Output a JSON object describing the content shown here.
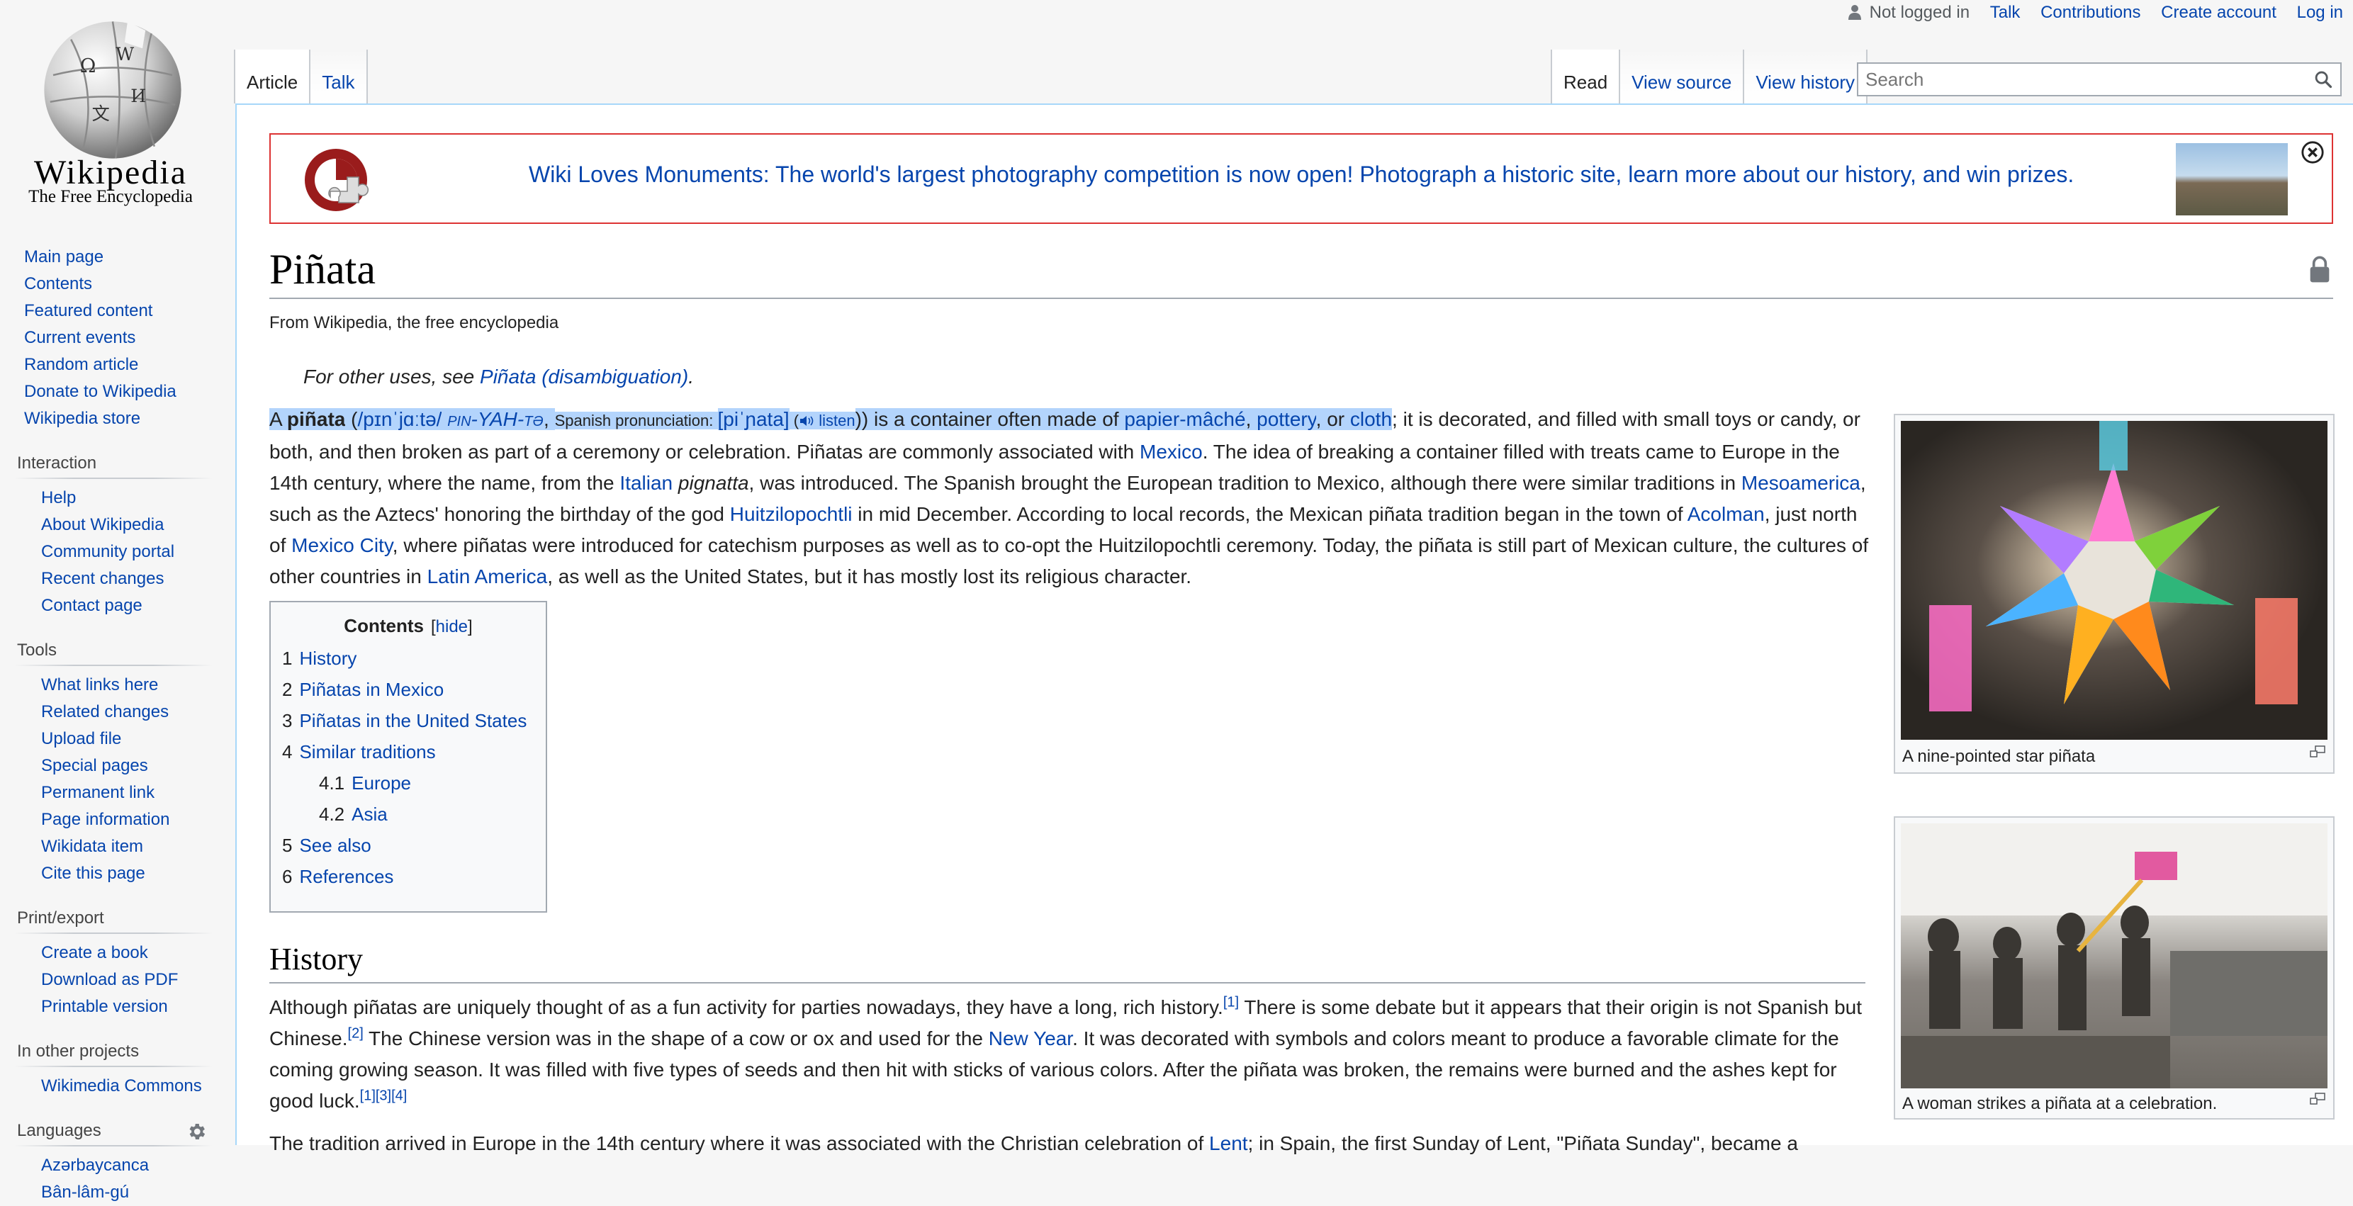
{
  "logo": {
    "wordmark": "Wikipedia",
    "tagline": "The Free Encyclopedia"
  },
  "personal": {
    "not_logged_in": "Not logged in",
    "talk": "Talk",
    "contributions": "Contributions",
    "create_account": "Create account",
    "log_in": "Log in"
  },
  "tabs": {
    "article": "Article",
    "talk": "Talk",
    "read": "Read",
    "view_source": "View source",
    "view_history": "View history"
  },
  "search": {
    "placeholder": "Search"
  },
  "sidebar": {
    "navigation": [
      "Main page",
      "Contents",
      "Featured content",
      "Current events",
      "Random article",
      "Donate to Wikipedia",
      "Wikipedia store"
    ],
    "interaction_heading": "Interaction",
    "interaction": [
      "Help",
      "About Wikipedia",
      "Community portal",
      "Recent changes",
      "Contact page"
    ],
    "tools_heading": "Tools",
    "tools": [
      "What links here",
      "Related changes",
      "Upload file",
      "Special pages",
      "Permanent link",
      "Page information",
      "Wikidata item",
      "Cite this page"
    ],
    "print_heading": "Print/export",
    "print": [
      "Create a book",
      "Download as PDF",
      "Printable version"
    ],
    "projects_heading": "In other projects",
    "projects": [
      "Wikimedia Commons"
    ],
    "languages_heading": "Languages",
    "languages": [
      "Azərbaycanca",
      "Bân-lâm-gú"
    ]
  },
  "banner": {
    "text": "Wiki Loves Monuments: The world's largest photography competition is now open! Photograph a historic site, learn more about our history, and win prizes."
  },
  "article": {
    "title": "Piñata",
    "tagline": "From Wikipedia, the free encyclopedia",
    "hatnote_prefix": "For other uses, see ",
    "hatnote_link": "Piñata (disambiguation)",
    "hatnote_suffix": ".",
    "p1": {
      "a": "A ",
      "piñata": "piñata",
      "b": " (",
      "ipa": "/pɪnˈjɑːtə/",
      "respell": "pin-YAH-tə",
      "c": ", ",
      "spanish_pron": "Spanish pronunciation: ",
      "spanish_ipa": "[piˈɲata]",
      "d": " (",
      "listen": "listen",
      "e": ")) is a container often made of ",
      "papier": "papier-mâché",
      "f": ", ",
      "pottery": "pottery",
      "g": ", or ",
      "cloth": "cloth",
      "h": "; it is decorated, and filled with small toys or candy, or both, and then broken as part of a ceremony or celebration. Piñatas are commonly associated with ",
      "mexico": "Mexico",
      "i": ". The idea of breaking a container filled with treats came to Europe in the 14th century, where the name, from the ",
      "italian": "Italian",
      "j": " ",
      "pignatta": "pignatta",
      "k": ", was introduced. The Spanish brought the European tradition to Mexico, although there were similar traditions in ",
      "mesoamerica": "Mesoamerica",
      "l": ", such as the Aztecs' honoring the birthday of the god ",
      "huitz": "Huitzilopochtli",
      "m": " in mid December. According to local records, the Mexican piñata tradition began in the town of ",
      "acolman": "Acolman",
      "n": ", just north of ",
      "mexico_city": "Mexico City",
      "o": ", where piñatas were introduced for catechism purposes as well as to co-opt the Huitzilopochtli ceremony. Today, the piñata is still part of Mexican culture, the cultures of other countries in ",
      "latin_america": "Latin America",
      "p": ", as well as the United States, but it has mostly lost its religious character."
    },
    "toc": {
      "title": "Contents",
      "hide": "hide",
      "items": [
        {
          "num": "1",
          "label": "History"
        },
        {
          "num": "2",
          "label": "Piñatas in Mexico"
        },
        {
          "num": "3",
          "label": "Piñatas in the United States"
        },
        {
          "num": "4",
          "label": "Similar traditions"
        },
        {
          "num": "4.1",
          "label": "Europe"
        },
        {
          "num": "4.2",
          "label": "Asia"
        },
        {
          "num": "5",
          "label": "See also"
        },
        {
          "num": "6",
          "label": "References"
        }
      ]
    },
    "history_heading": "History",
    "p2": {
      "a": "Although piñatas are uniquely thought of as a fun activity for parties nowadays, they have a long, rich history.",
      "ref1": "[1]",
      "b": " There is some debate but it appears that their origin is not Spanish but Chinese.",
      "ref2": "[2]",
      "c": " The Chinese version was in the shape of a cow or ox and used for the ",
      "new_year": "New Year",
      "d": ". It was decorated with symbols and colors meant to produce a favorable climate for the coming growing season. It was filled with five types of seeds and then hit with sticks of various colors. After the piñata was broken, the remains were burned and the ashes kept for good luck.",
      "ref134": "[1][3][4]"
    },
    "p3": {
      "a": "The tradition arrived in Europe in the 14th century where it was associated with the Christian celebration of ",
      "lent": "Lent",
      "b": "; in Spain, the first Sunday of Lent, \"Piñata Sunday\", became a"
    },
    "captions": {
      "thumb1": "A nine-pointed star piñata",
      "thumb2": "A woman strikes a piñata at a celebration."
    }
  },
  "colors": {
    "link": "#0645ad",
    "banner_border": "#dd3333",
    "selection": "#b3d4fc"
  }
}
